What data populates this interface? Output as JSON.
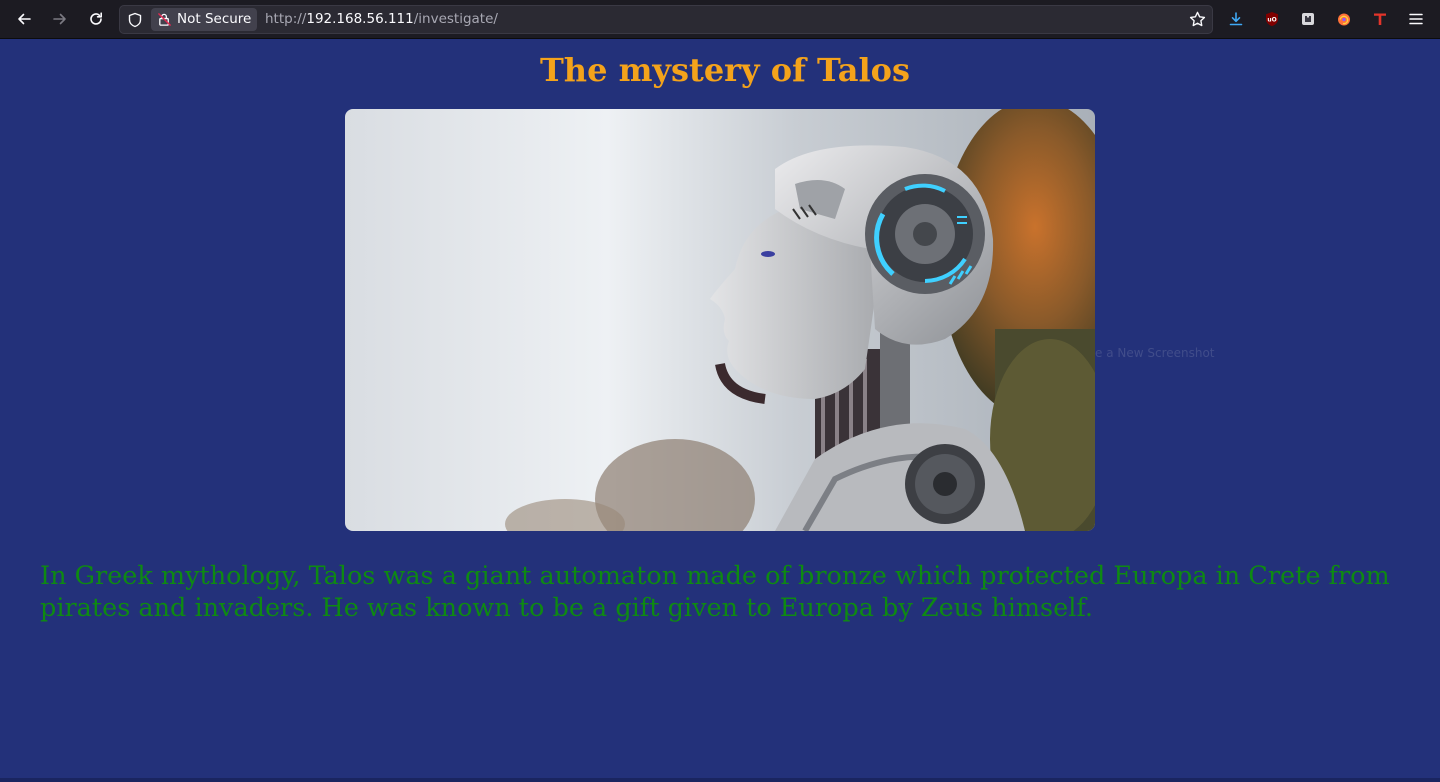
{
  "browser": {
    "security_label": "Not Secure",
    "url_scheme": "http://",
    "url_host": "192.168.56.111",
    "url_path": "/investigate/",
    "icons": [
      "back-arrow-icon",
      "forward-arrow-icon",
      "reload-icon",
      "shield-icon",
      "insecure-lock-icon",
      "bookmark-star-icon",
      "download-icon",
      "ublock-origin-icon",
      "extension-icon",
      "firefox-relay-icon",
      "t-extension-icon",
      "hamburger-menu-icon"
    ]
  },
  "page": {
    "title": "The mystery of Talos",
    "hero_image": "robot-head-profile-image",
    "intro_text": "In Greek mythology, Talos was a giant automaton made of bronze which protected Europa in Crete from pirates and invaders. He was known to be a gift given to Europa by Zeus himself.",
    "ghost_text": "e a New Screenshot"
  },
  "colors": {
    "background": "#23317a",
    "title": "#f4a31b",
    "intro": "#0e8a12",
    "toolbar": "#1c1b22"
  }
}
